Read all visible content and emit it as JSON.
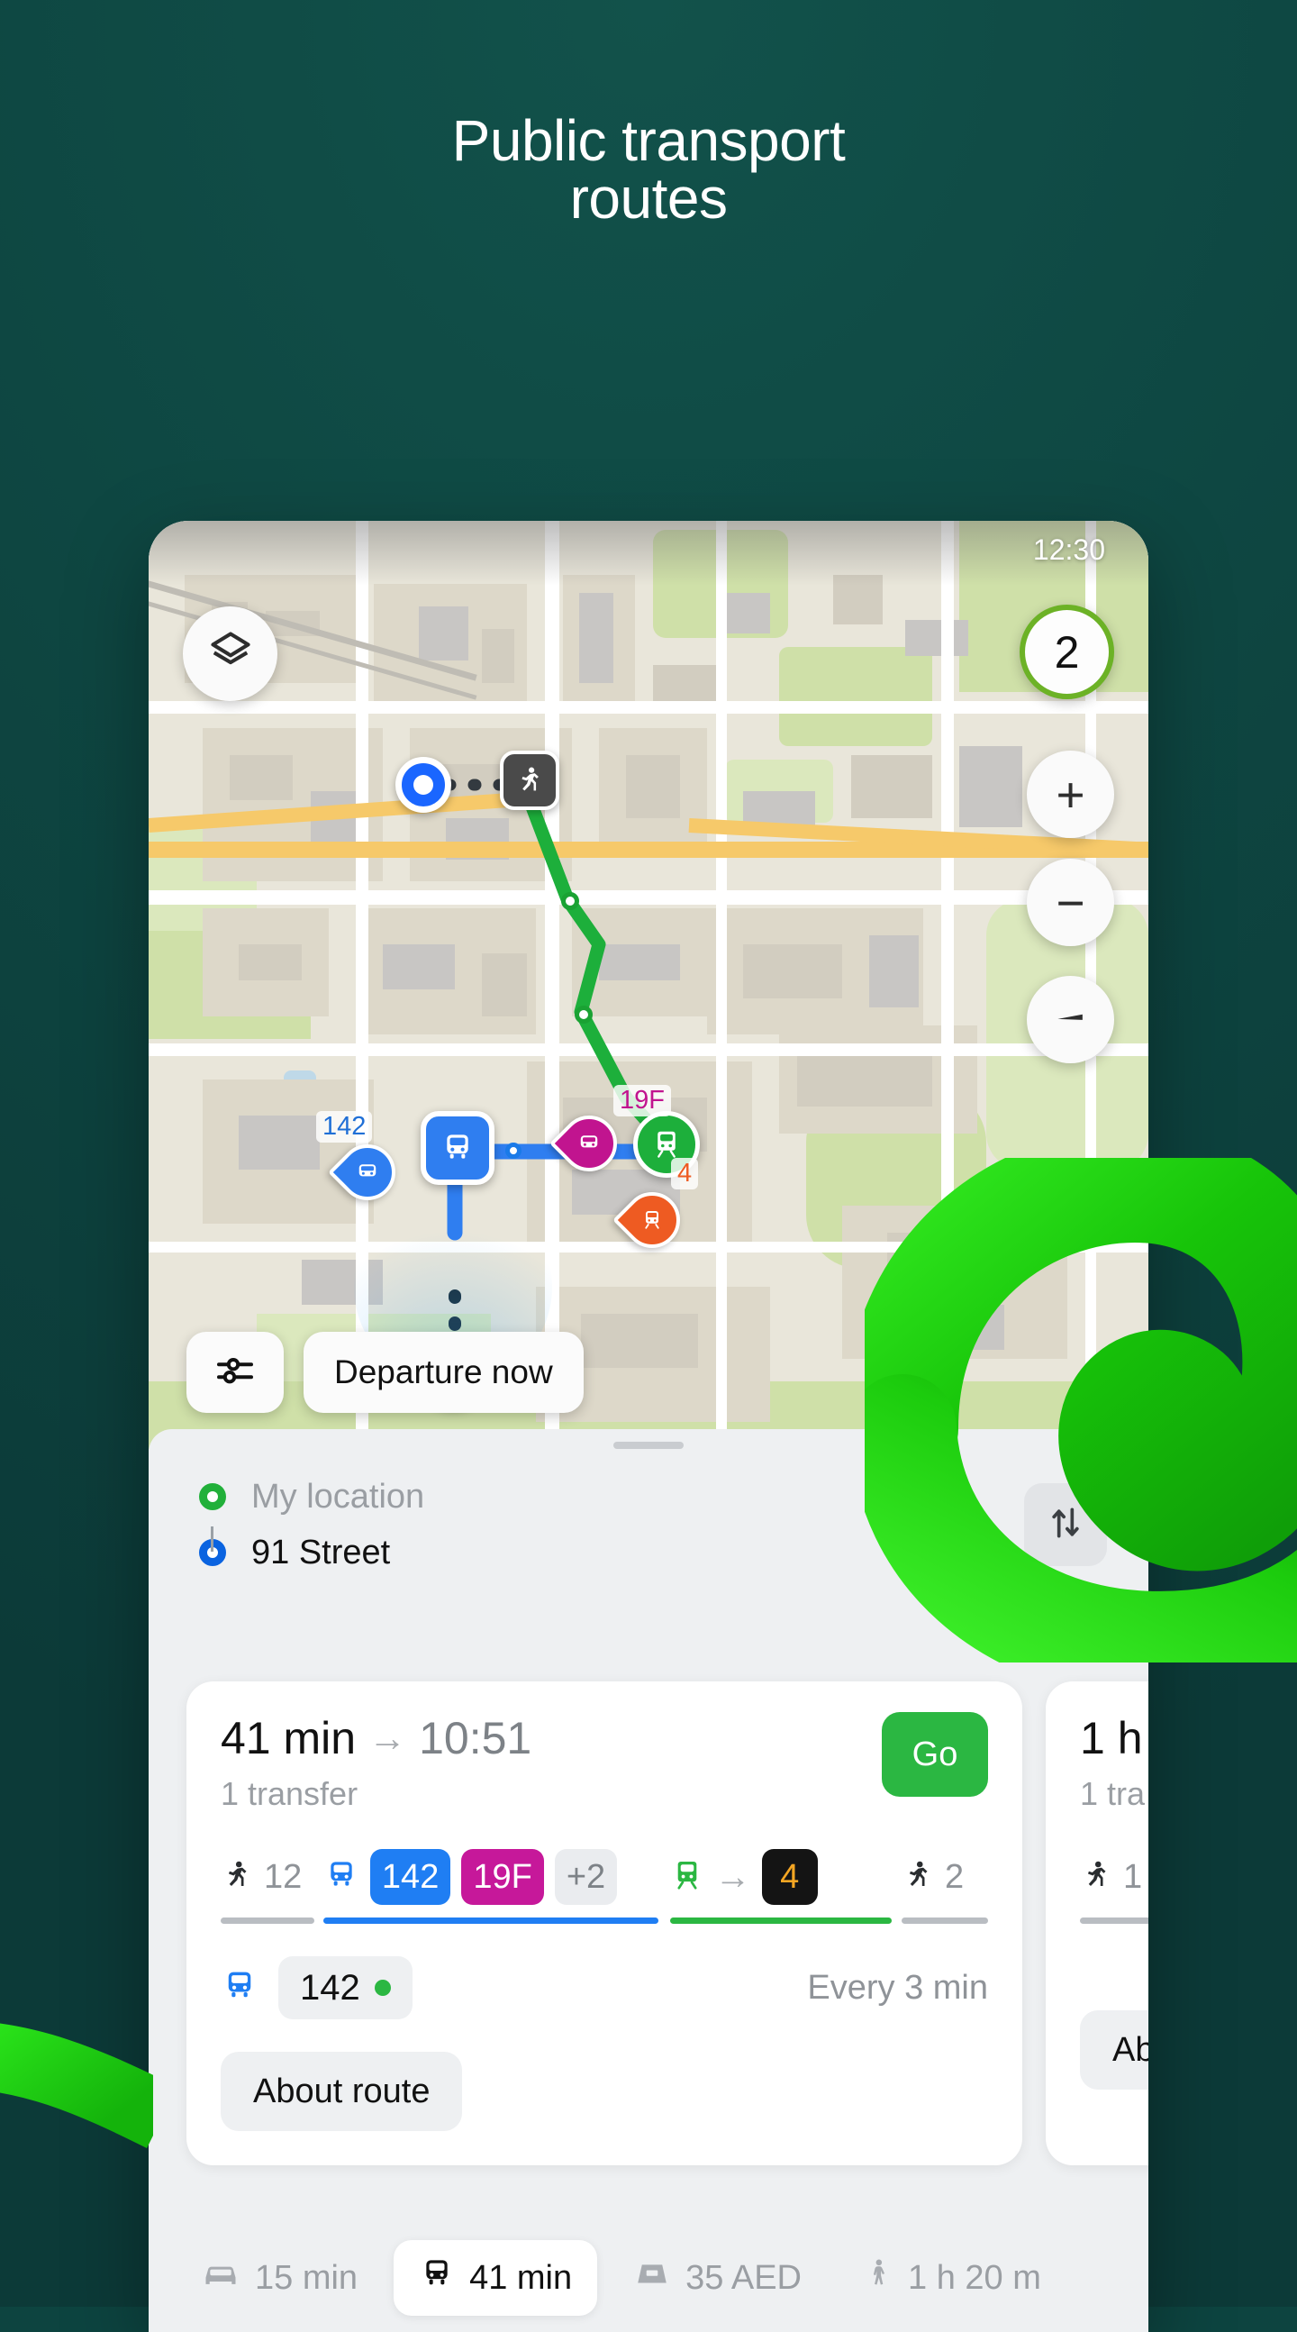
{
  "hero": {
    "title": "Public transport\nroutes"
  },
  "theme": {
    "background": "#0d4440",
    "accent_green": "#20d316",
    "brand_green": "#2bb742",
    "route_blue": "#1f7ef3",
    "route_magenta": "#c6189a",
    "route_orange": "#ee5b22"
  },
  "map": {
    "status_time": "12:30",
    "layers_button_icon": "layers-icon",
    "route_count_badge": "2",
    "zoom_in_label": "+",
    "zoom_out_label": "−",
    "compass_icon": "compass-icon",
    "markers": [
      {
        "name": "start-point",
        "type": "origin-dot"
      },
      {
        "name": "walk-segment",
        "type": "walk-chip",
        "icon": "walk-icon"
      },
      {
        "name": "train-station",
        "type": "train-pin",
        "icon": "train-icon"
      },
      {
        "name": "bus-stop-selected",
        "type": "bus-square",
        "icon": "bus-icon"
      },
      {
        "name": "bus-stop-142",
        "label": "142",
        "type": "bus-teardrop"
      },
      {
        "name": "bus-stop-19F",
        "label": "19F",
        "type": "bus-teardrop"
      },
      {
        "name": "tram-stop-4",
        "label": "4",
        "type": "tram-teardrop"
      },
      {
        "name": "my-location",
        "type": "me-dot"
      }
    ],
    "filter_button_icon": "sliders-icon",
    "departure_chip": "Departure now"
  },
  "sheet": {
    "origin": {
      "label": "My location"
    },
    "destination": {
      "label": "91 Street"
    },
    "swap_icon": "swap-vertical-icon",
    "cards": [
      {
        "duration": "41 min",
        "arrow": "→",
        "eta": "10:51",
        "transfers": "1 transfer",
        "go_label": "Go",
        "segments": [
          {
            "kind": "walk",
            "icon": "walk-icon",
            "value": "12",
            "bar_color": "#b9bdc2"
          },
          {
            "kind": "bus",
            "icon": "bus-icon",
            "badges": [
              "142",
              "19F",
              "+2"
            ],
            "bar_color": "#1f7ef3"
          },
          {
            "kind": "train",
            "icon": "train-icon",
            "arrow": "→",
            "badges": [
              "4"
            ],
            "bar_color": "#2bb742"
          },
          {
            "kind": "walk",
            "icon": "walk-icon",
            "value": "2",
            "bar_color": "#b9bdc2"
          }
        ],
        "line_icon": "bus-icon",
        "line_number": "142",
        "frequency": "Every 3 min",
        "about_label": "About route"
      },
      {
        "duration": "1 h",
        "transfers": "1 tra",
        "segments": [
          {
            "kind": "walk",
            "icon": "walk-icon",
            "value": "1",
            "bar_color": "#b9bdc2"
          }
        ],
        "about_label": "Ab"
      }
    ],
    "modes": [
      {
        "icon": "car-icon",
        "label": "15 min",
        "active": false
      },
      {
        "icon": "bus-icon",
        "label": "41 min",
        "active": true
      },
      {
        "icon": "taxi-icon",
        "label": "35 AED",
        "active": false
      },
      {
        "icon": "walk-icon",
        "label": "1 h 20 m",
        "active": false
      }
    ]
  }
}
